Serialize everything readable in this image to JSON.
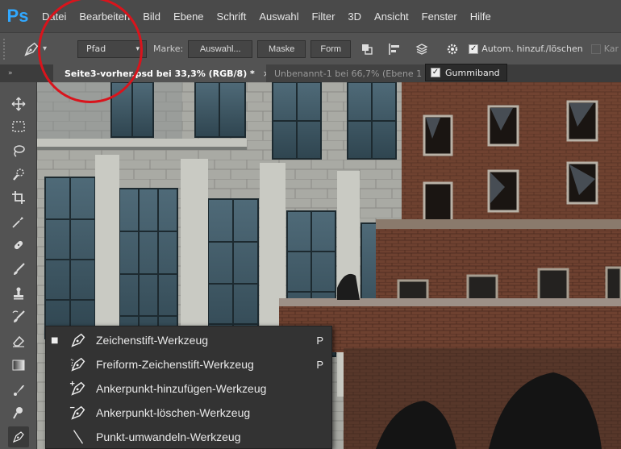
{
  "app": {
    "logo": "Ps"
  },
  "menu": [
    "Datei",
    "Bearbeiten",
    "Bild",
    "Ebene",
    "Schrift",
    "Auswahl",
    "Filter",
    "3D",
    "Ansicht",
    "Fenster",
    "Hilfe"
  ],
  "options": {
    "mode_select": "Pfad",
    "marke_label": "Marke:",
    "auswahl_button": "Auswahl...",
    "maske_button": "Maske",
    "form_button": "Form",
    "autom_label": "Autom. hinzuf./löschen",
    "kanten_label": "Kar"
  },
  "tabs": [
    {
      "label": "Seite3-vorher.psd bei 33,3% (RGB/8) *",
      "close": "×"
    },
    {
      "label": "Unbenannt-1 bei 66,7% (Ebene 1"
    }
  ],
  "tooltip": {
    "label": "Gummiband"
  },
  "flyout": {
    "items": [
      {
        "label": "Zeichenstift-Werkzeug",
        "key": "P",
        "selected_marker": "■"
      },
      {
        "label": "Freiform-Zeichenstift-Werkzeug",
        "key": "P"
      },
      {
        "label": "Ankerpunkt-hinzufügen-Werkzeug",
        "key": ""
      },
      {
        "label": "Ankerpunkt-löschen-Werkzeug",
        "key": ""
      },
      {
        "label": "Punkt-umwandeln-Werkzeug",
        "key": ""
      }
    ]
  },
  "colors": {
    "annotation": "#d9141c",
    "ps_blue": "#31a8ff"
  }
}
